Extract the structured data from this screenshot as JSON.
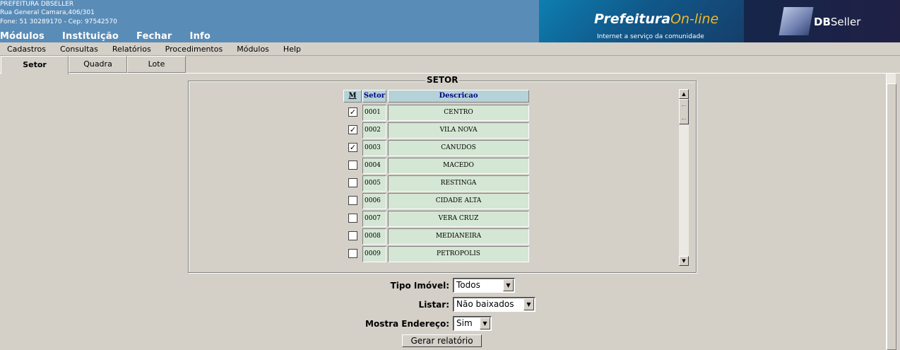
{
  "header": {
    "org_name": "PREFEITURA DBSELLER",
    "address": "Rua General Camara,406/301",
    "phone_line": "Fone: 51 30289170  -  Cep: 97542570",
    "menu": [
      "Módulos",
      "Instituição",
      "Fechar",
      "Info"
    ],
    "brand_main": "Prefeitura",
    "brand_online": "On-line",
    "brand_tagline": "Internet a serviço da comunidade",
    "db_logo_bold": "DB",
    "db_logo_rest": "Seller"
  },
  "menubar": [
    "Cadastros",
    "Consultas",
    "Relatórios",
    "Procedimentos",
    "Módulos",
    "Help"
  ],
  "tabs": [
    {
      "label": "Setor",
      "active": true
    },
    {
      "label": "Quadra",
      "active": false
    },
    {
      "label": "Lote",
      "active": false
    }
  ],
  "fieldset": {
    "legend": "SETOR",
    "columns": {
      "m": "M",
      "setor": "Setor",
      "descricao": "Descricao"
    },
    "rows": [
      {
        "code": "0001",
        "desc": "CENTRO",
        "checked": true
      },
      {
        "code": "0002",
        "desc": "VILA NOVA",
        "checked": true
      },
      {
        "code": "0003",
        "desc": "CANUDOS",
        "checked": true
      },
      {
        "code": "0004",
        "desc": "MACEDO",
        "checked": false
      },
      {
        "code": "0005",
        "desc": "RESTINGA",
        "checked": false
      },
      {
        "code": "0006",
        "desc": "CIDADE ALTA",
        "checked": false
      },
      {
        "code": "0007",
        "desc": "VERA CRUZ",
        "checked": false
      },
      {
        "code": "0008",
        "desc": "MEDIANEIRA",
        "checked": false
      },
      {
        "code": "0009",
        "desc": "PETROPOLIS",
        "checked": false
      }
    ]
  },
  "form": {
    "tipo_imovel_label": "Tipo Imóvel:",
    "tipo_imovel_value": "Todos",
    "listar_label": "Listar:",
    "listar_value": "Não baixados",
    "mostra_endereco_label": "Mostra Endereço:",
    "mostra_endereco_value": "Sim",
    "submit_label": "Gerar relatório"
  },
  "colors": {
    "header_bg": "#5a8cb8",
    "grid_header_bg": "#b5d2d8",
    "grid_cell_bg": "#d4e6d4",
    "window_bg": "#d4d0c8",
    "brand_online": "#f0b828"
  },
  "icons": {
    "checkbox_checked": "check-mark",
    "scroll_up": "triangle-up",
    "scroll_down": "triangle-down",
    "dropdown": "triangle-down"
  }
}
